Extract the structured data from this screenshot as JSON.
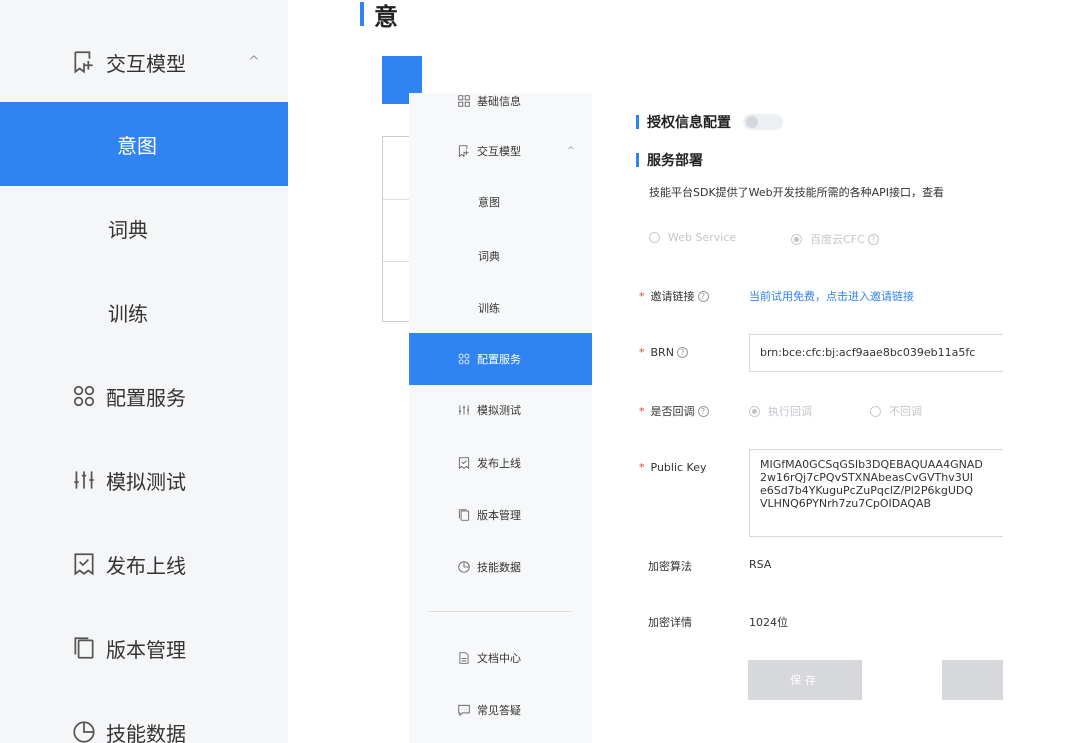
{
  "bg_sidebar": {
    "items": [
      {
        "label": "交互模型",
        "icon": "interaction-model-icon",
        "chevron": "^"
      },
      {
        "label": "意图"
      },
      {
        "label": "词典"
      },
      {
        "label": "训练"
      },
      {
        "label": "配置服务",
        "icon": "config-service-icon"
      },
      {
        "label": "模拟测试",
        "icon": "simulate-test-icon"
      },
      {
        "label": "发布上线",
        "icon": "publish-icon"
      },
      {
        "label": "版本管理",
        "icon": "version-icon"
      },
      {
        "label": "技能数据",
        "icon": "skill-data-icon"
      }
    ]
  },
  "bg_main": {
    "title": "意"
  },
  "fg_sidebar": {
    "items": [
      {
        "label": "基础信息",
        "icon": "grid-icon"
      },
      {
        "label": "交互模型",
        "icon": "interaction-model-icon",
        "chevron": "^"
      },
      {
        "label": "意图"
      },
      {
        "label": "词典"
      },
      {
        "label": "训练"
      },
      {
        "label": "配置服务",
        "icon": "config-service-icon"
      },
      {
        "label": "模拟测试",
        "icon": "simulate-test-icon"
      },
      {
        "label": "发布上线",
        "icon": "publish-icon"
      },
      {
        "label": "版本管理",
        "icon": "version-icon"
      },
      {
        "label": "技能数据",
        "icon": "skill-data-icon"
      },
      {
        "label": "文档中心",
        "icon": "document-icon"
      },
      {
        "label": "常见答疑",
        "icon": "faq-icon"
      }
    ]
  },
  "content": {
    "auth_title": "授权信息配置",
    "deploy_title": "服务部署",
    "description": "技能平台SDK提供了Web开发技能所需的各种API接口，查看",
    "service_options": [
      "Web Service",
      "百度云CFC"
    ],
    "invite_label": "邀请链接",
    "invite_link": "当前试用免费，点击进入邀请链接",
    "brn_label": "BRN",
    "brn_value": "brn:bce:cfc:bj:acf9aae8bc039eb11a5fc",
    "callback_label": "是否回调",
    "callback_options": [
      "执行回调",
      "不回调"
    ],
    "pubkey_label": "Public Key",
    "pubkey_lines": [
      "MIGfMA0GCSqGSIb3DQEBAQUAA4GNAD",
      "2w16rQj7cPQvSTXNAbeasCvGVThv3UI",
      "e6Sd7b4YKuguPcZuPqclZ/Pl2P6kgUDQ",
      "VLHNQ6PYNrh7zu7CpOIDAQAB"
    ],
    "algo_label": "加密算法",
    "algo_value": "RSA",
    "detail_label": "加密详情",
    "detail_value": "1024位",
    "save_label": "保存",
    "required_mark": "*",
    "help_mark": "?"
  },
  "colors": {
    "accent": "#2f83f3",
    "required": "#e0423b",
    "disabled_button": "#d6d8dc"
  }
}
